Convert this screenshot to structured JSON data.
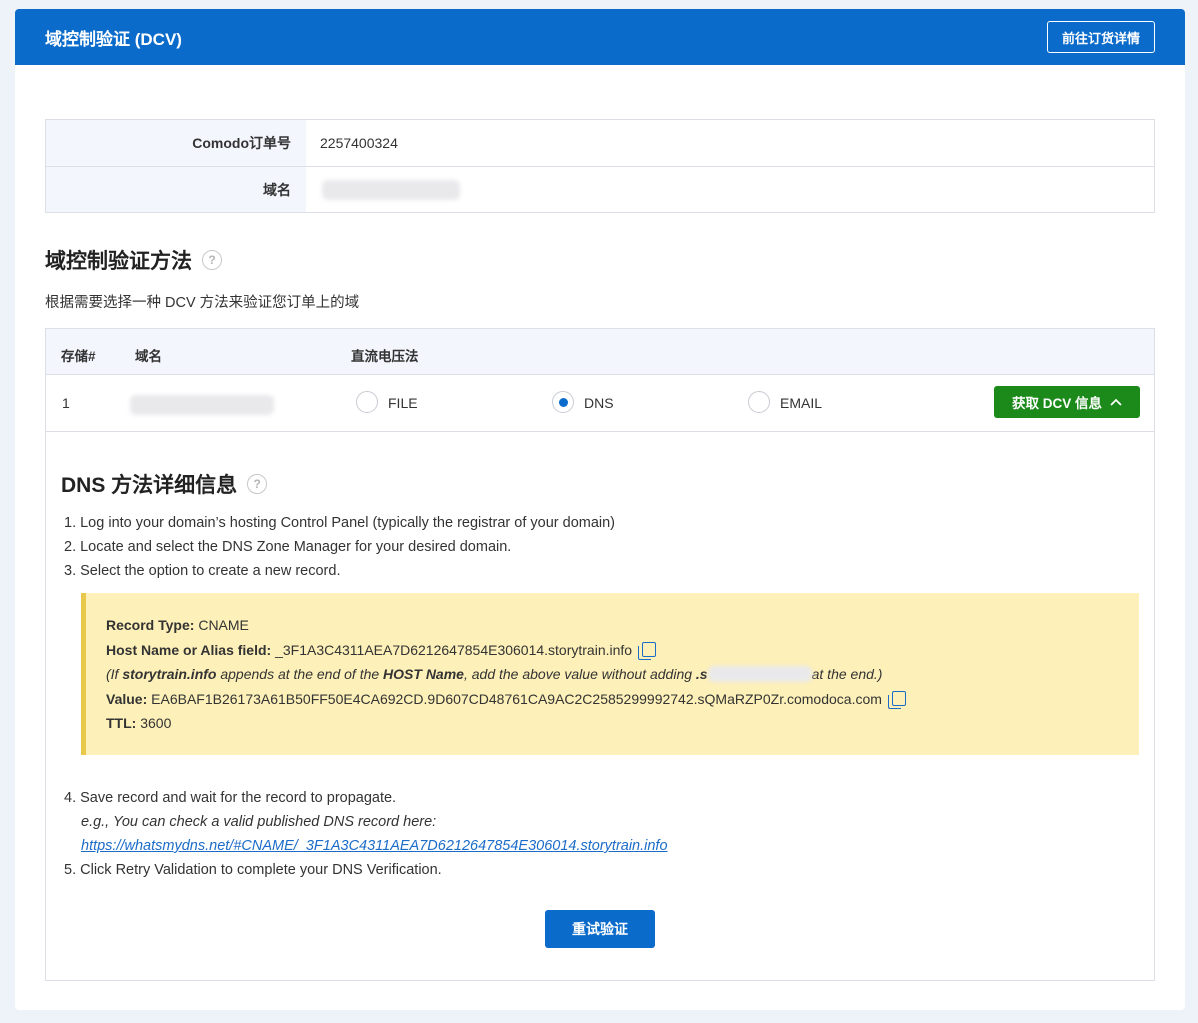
{
  "header": {
    "title": "域控制验证 (DCV)",
    "order_button": "前往订货详情"
  },
  "order_info": {
    "order_label": "Comodo订单号",
    "order_value": "2257400324",
    "domain_label": "域名"
  },
  "method_section": {
    "title": "域控制验证方法",
    "help": "?",
    "description": "根据需要选择一种 DCV 方法来验证您订单上的域"
  },
  "dcv_table": {
    "headers": {
      "index": "存储#",
      "domain": "域名",
      "method": "直流电压法"
    },
    "row": {
      "index": "1",
      "options": [
        "FILE",
        "DNS",
        "EMAIL"
      ],
      "selected": "DNS",
      "get_button": "获取 DCV 信息"
    }
  },
  "dns_details": {
    "title": "DNS 方法详细信息",
    "help": "?",
    "steps_top": [
      "1. Log into your domain’s hosting Control Panel (typically the registrar of your domain)",
      "2. Locate and select the DNS Zone Manager for your desired domain.",
      "3. Select the option to create a new record."
    ],
    "record": {
      "type_label": "Record Type:",
      "type_value": "CNAME",
      "host_label": "Host Name or Alias field:",
      "host_value": "_3F1A3C4311AEA7D6212647854E306014.storytrain.info",
      "note_prefix": "(If ",
      "note_domain": "storytrain.info",
      "note_mid": " appends at the end of the ",
      "note_host": "HOST Name",
      "note_mid2": ", add the above value without adding ",
      "note_dot": ".s",
      "note_suffix": "at the end.)",
      "value_label": "Value:",
      "value_value": "EA6BAF1B26173A61B50FF50E4CA692CD.9D607CD48761CA9AC2C2585299992742.sQMaRZP0Zr.comodoca.com",
      "ttl_label": "TTL:",
      "ttl_value": "3600"
    },
    "step4": "4. Save record and wait for the record to propagate.",
    "step4_eg": "e.g., You can check a valid published DNS record here:",
    "step4_link": "https://whatsmydns.net/#CNAME/_3F1A3C4311AEA7D6212647854E306014.storytrain.info",
    "step5": "5. Click Retry Validation to complete your DNS Verification.",
    "retry_button": "重试验证"
  },
  "colors": {
    "primary": "#0a6bcb",
    "success": "#1b8a1b",
    "note_bg": "#fdf0b8"
  }
}
